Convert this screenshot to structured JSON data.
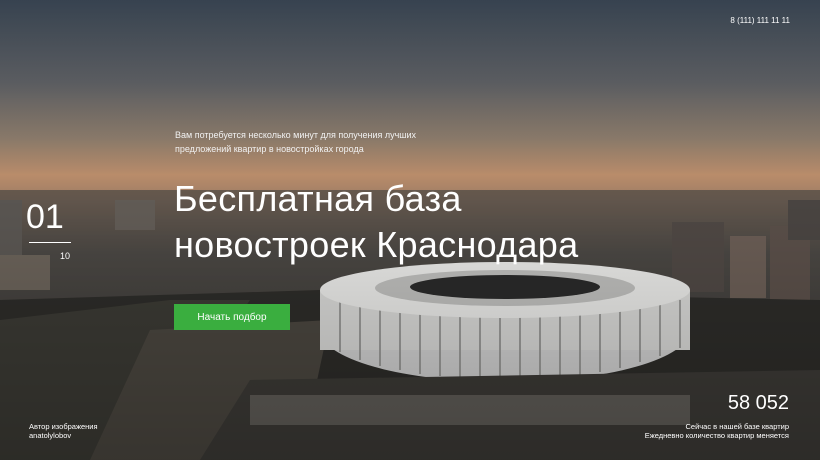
{
  "header": {
    "phone": "8 (111) 111 11 11"
  },
  "hero": {
    "subtitle_line1": "Вам потребуется несколько минут для получения лучших",
    "subtitle_line2": "предложений квартир в новостройках города",
    "title_line1": "Бесплатная база",
    "title_line2": "новостроек Краснодара",
    "cta_label": "Начать подбор",
    "accent_color": "#3aae3f"
  },
  "slider": {
    "current": "01",
    "total": "10"
  },
  "credit": {
    "line1": "Автор изображения",
    "line2": "anatolylobov"
  },
  "stats": {
    "count": "58 052",
    "line1": "Сейчас в нашей базе квартир",
    "line2": "Ежедневно количество квартир меняется"
  }
}
